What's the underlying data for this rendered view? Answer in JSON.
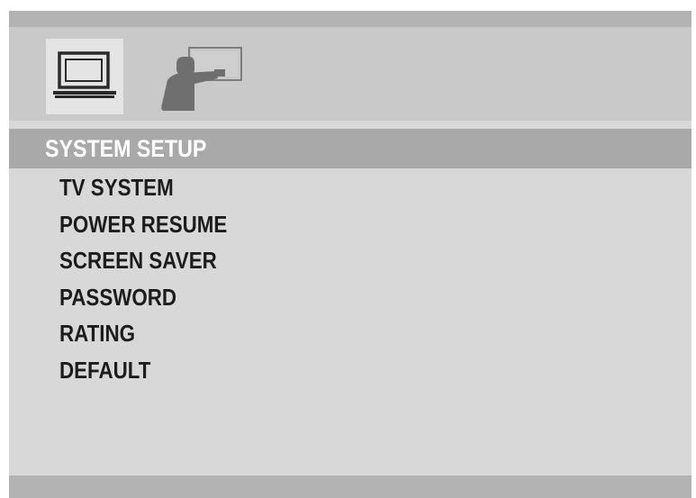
{
  "tabs": [
    {
      "icon": "monitor-icon",
      "selected": true
    },
    {
      "icon": "person-at-screen-icon",
      "selected": false
    }
  ],
  "section": {
    "title": "SYSTEM SETUP"
  },
  "menu": {
    "items": [
      {
        "label": "TV SYSTEM"
      },
      {
        "label": "POWER RESUME"
      },
      {
        "label": "SCREEN SAVER"
      },
      {
        "label": "PASSWORD"
      },
      {
        "label": "RATING"
      },
      {
        "label": "DEFAULT"
      }
    ]
  },
  "colors": {
    "panel": "#d8d8d8",
    "icon_bar": "#c9c9c9",
    "header": "#a9a9a9",
    "band": "#b3b3b3",
    "header_text": "#ffffff",
    "item_text": "#1c1c1c"
  }
}
